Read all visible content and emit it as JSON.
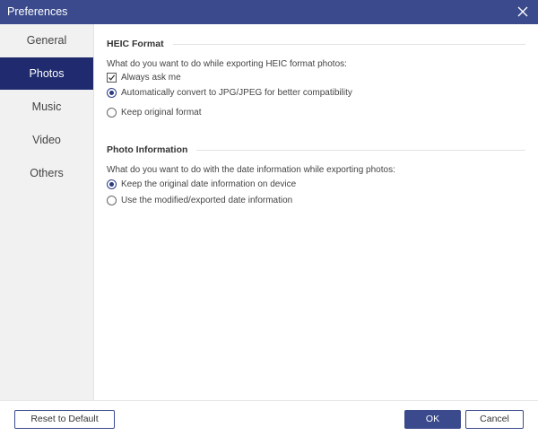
{
  "window": {
    "title": "Preferences",
    "close_icon": "close-icon"
  },
  "sidebar": {
    "items": [
      {
        "label": "General",
        "active": false
      },
      {
        "label": "Photos",
        "active": true
      },
      {
        "label": "Music",
        "active": false
      },
      {
        "label": "Video",
        "active": false
      },
      {
        "label": "Others",
        "active": false
      }
    ]
  },
  "heic": {
    "heading": "HEIC Format",
    "question": "What do you want to do while exporting HEIC format photos:",
    "always_ask": {
      "label": "Always ask me",
      "checked": true
    },
    "options": [
      {
        "label": "Automatically convert to JPG/JPEG for better compatibility",
        "selected": true
      },
      {
        "label": "Keep original format",
        "selected": false
      }
    ]
  },
  "photo_info": {
    "heading": "Photo Information",
    "question": "What do you want to do with the date information while exporting photos:",
    "options": [
      {
        "label": "Keep the original date information on device",
        "selected": true
      },
      {
        "label": "Use the modified/exported date information",
        "selected": false
      }
    ]
  },
  "footer": {
    "reset_label": "Reset to Default",
    "ok_label": "OK",
    "cancel_label": "Cancel"
  },
  "colors": {
    "titlebar": "#3a4a8c",
    "active_nav": "#1f2b6e",
    "accent": "#2b3a84"
  }
}
